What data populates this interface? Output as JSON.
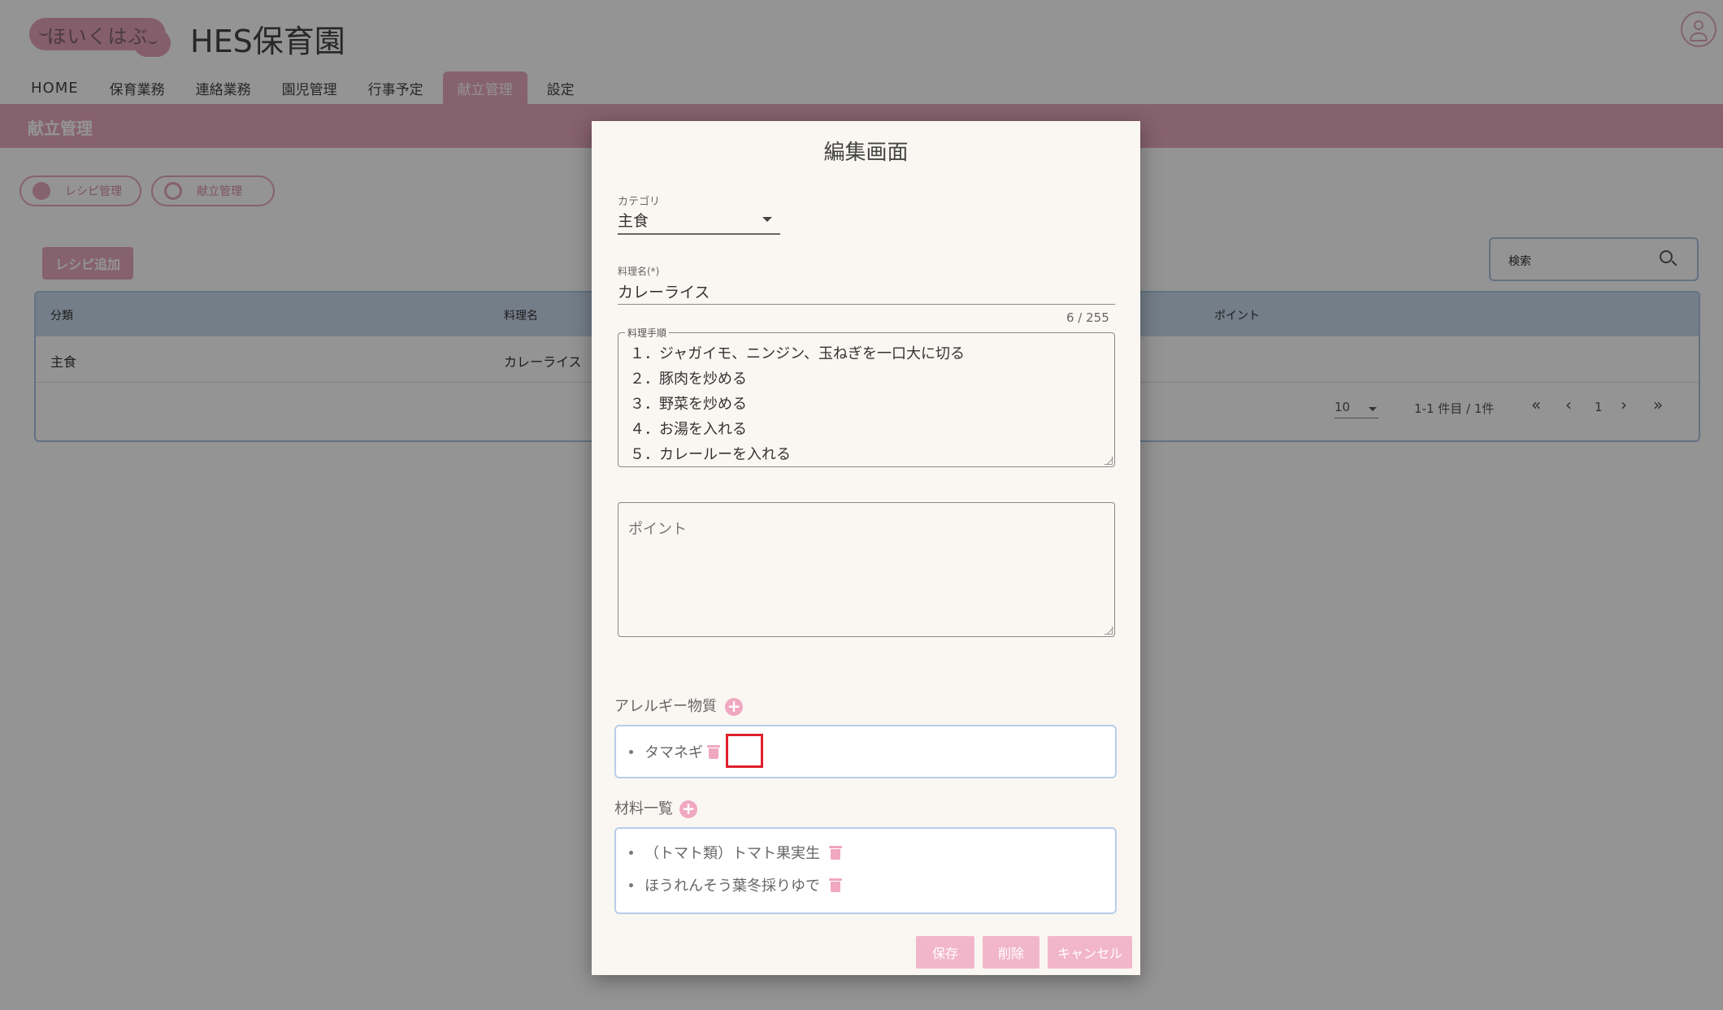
{
  "app": {
    "logo_text": "ほいくはぶ",
    "site_title": "HES保育園"
  },
  "nav": {
    "items": [
      {
        "label": "HOME"
      },
      {
        "label": "保育業務"
      },
      {
        "label": "連絡業務"
      },
      {
        "label": "園児管理"
      },
      {
        "label": "行事予定"
      },
      {
        "label": "献立管理",
        "active": true
      },
      {
        "label": "設定"
      }
    ]
  },
  "page": {
    "title": "献立管理",
    "pills": [
      "レシピ管理",
      "献立管理"
    ],
    "add_button": "レシピ追加",
    "search_placeholder": "検索"
  },
  "table": {
    "headers": [
      "分類",
      "料理名",
      "ポイント"
    ],
    "rows": [
      [
        "主食",
        "カレーライス"
      ]
    ],
    "pagination": {
      "per_page": "10",
      "range": "1-1 件目 / 1件",
      "first": "«",
      "prev": "‹",
      "page": "1",
      "next": "›",
      "last": "»"
    }
  },
  "modal": {
    "title": "編集画面",
    "category": {
      "label": "カテゴリ",
      "value": "主食"
    },
    "dish_name": {
      "label": "料理名(*)",
      "value": "カレーライス",
      "counter": "6 / 255"
    },
    "steps": {
      "label": "料理手順",
      "lines": [
        "１．ジャガイモ、ニンジン、玉ねぎを一口大に切る",
        "２．豚肉を炒める",
        "３．野菜を炒める",
        "４．お湯を入れる",
        "５．カレールーを入れる"
      ]
    },
    "point": {
      "placeholder": "ポイント"
    },
    "allergens": {
      "label": "アレルギー物質",
      "items": [
        "タマネギ"
      ]
    },
    "ingredients": {
      "label": "材料一覧",
      "items": [
        "（トマト類）トマト果実生",
        "ほうれんそう葉冬採りゆで"
      ]
    },
    "buttons": {
      "save": "保存",
      "delete": "削除",
      "cancel": "キャンセル"
    }
  },
  "colors": {
    "accent_pink": "#e7a7bd",
    "highlight_red": "#e0202c",
    "table_header_blue": "#c8d9ec"
  }
}
